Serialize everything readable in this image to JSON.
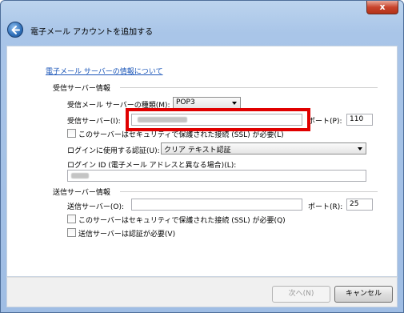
{
  "window": {
    "close_label": "x",
    "title": "電子メール アカウントを追加する"
  },
  "info_link": "電子メール サーバーの情報について",
  "incoming": {
    "section_title": "受信サーバー情報",
    "type_label": "受信メール サーバーの種類(M):",
    "type_value": "POP3",
    "server_label": "受信サーバー(I):",
    "server_value": "",
    "port_label": "ポート(P):",
    "port_value": "110",
    "ssl_label": "このサーバーはセキュリティで保護された接続 (SSL) が必要(L)",
    "ssl_checked": false,
    "auth_label": "ログインに使用する認証(U):",
    "auth_value": "クリア テキスト認証",
    "login_id_label": "ログイン ID (電子メール アドレスと異なる場合)(L):",
    "login_id_value": ""
  },
  "outgoing": {
    "section_title": "送信サーバー情報",
    "server_label": "送信サーバー(O):",
    "server_value": "",
    "port_label": "ポート(R):",
    "port_value": "25",
    "ssl_label": "このサーバーはセキュリティで保護された接続 (SSL) が必要(Q)",
    "ssl_checked": false,
    "auth_required_label": "送信サーバーは認証が必要(V)",
    "auth_required_checked": false
  },
  "footer": {
    "next_label": "次へ(N)",
    "cancel_label": "キャンセル"
  },
  "colors": {
    "highlight_box": "#e00000",
    "link": "#1a55b8"
  }
}
